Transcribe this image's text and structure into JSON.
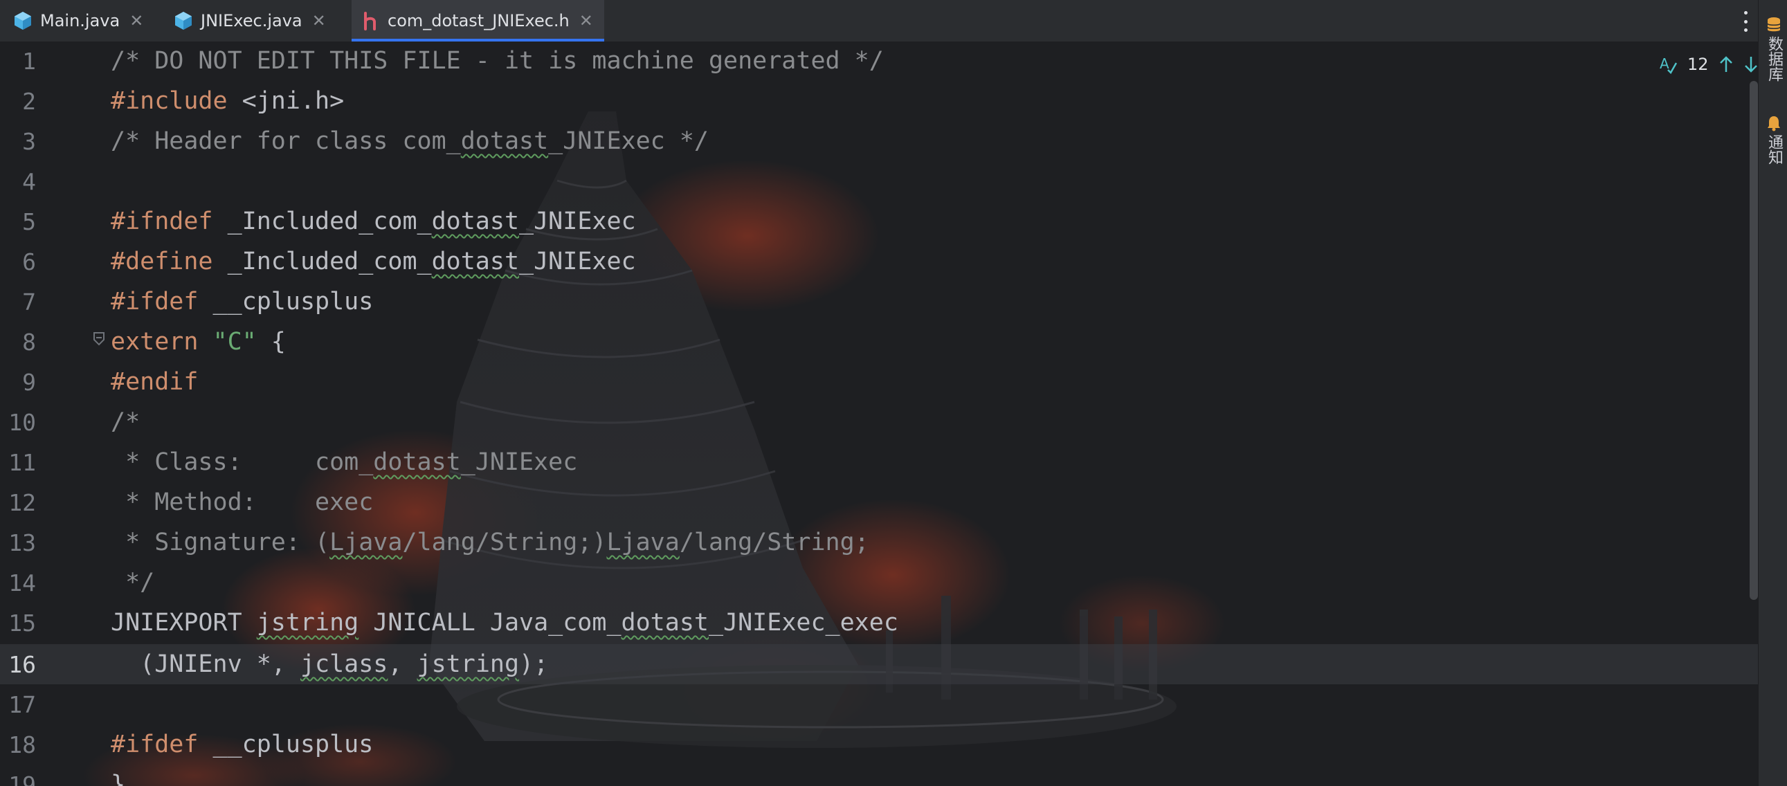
{
  "tabs": [
    {
      "label": "Main.java",
      "icon": "java-class-icon",
      "active": false
    },
    {
      "label": "JNIExec.java",
      "icon": "java-class-icon",
      "active": false
    },
    {
      "label": "com_dotast_JNIExec.h",
      "icon": "c-header-icon",
      "active": true
    }
  ],
  "right_strip": {
    "database_label": "数据库",
    "notifications_label": "通知"
  },
  "inspection": {
    "count": "12"
  },
  "editor": {
    "current_line": 16,
    "lines": [
      {
        "n": "1",
        "code": "/* DO NOT EDIT THIS FILE - it is machine generated */"
      },
      {
        "n": "2",
        "code": "#include <jni.h>"
      },
      {
        "n": "3",
        "code": "/* Header for class com_dotast_JNIExec */"
      },
      {
        "n": "4",
        "code": ""
      },
      {
        "n": "5",
        "code": "#ifndef _Included_com_dotast_JNIExec"
      },
      {
        "n": "6",
        "code": "#define _Included_com_dotast_JNIExec"
      },
      {
        "n": "7",
        "code": "#ifdef __cplusplus"
      },
      {
        "n": "8",
        "code": "extern \"C\" {"
      },
      {
        "n": "9",
        "code": "#endif"
      },
      {
        "n": "10",
        "code": "/*"
      },
      {
        "n": "11",
        "code": " * Class:     com_dotast_JNIExec"
      },
      {
        "n": "12",
        "code": " * Method:    exec"
      },
      {
        "n": "13",
        "code": " * Signature: (Ljava/lang/String;)Ljava/lang/String;"
      },
      {
        "n": "14",
        "code": " */"
      },
      {
        "n": "15",
        "code": "JNIEXPORT jstring JNICALL Java_com_dotast_JNIExec_exec"
      },
      {
        "n": "16",
        "code": "  (JNIEnv *, jclass, jstring);"
      },
      {
        "n": "17",
        "code": ""
      },
      {
        "n": "18",
        "code": "#ifdef __cplusplus"
      },
      {
        "n": "19",
        "code": "}"
      }
    ]
  },
  "colors": {
    "comment": "#8a8c8f",
    "directive": "#cf8e6d",
    "text": "#bcbec4",
    "string": "#6aab73",
    "active_tab_indicator": "#3574f0",
    "header_icon": "#e05c6c",
    "java_icon": "#4cb3e6"
  }
}
